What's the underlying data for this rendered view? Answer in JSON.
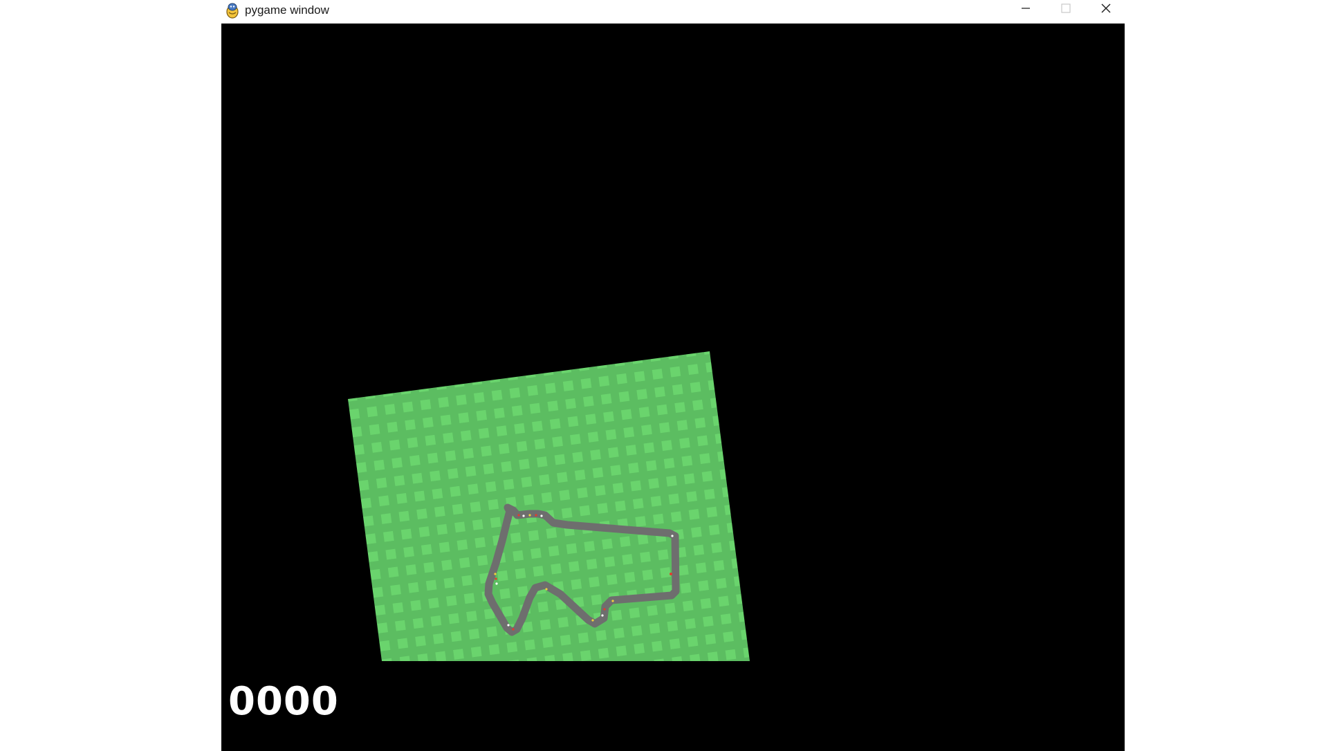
{
  "window": {
    "title": "pygame window",
    "icons": {
      "app": "pygame-snake-icon",
      "minimize": "minimize-icon",
      "maximize": "maximize-icon",
      "close": "close-icon"
    }
  },
  "game": {
    "score": "0000",
    "colors": {
      "background": "#000000",
      "grass": "#5cbd61",
      "grass_tile": "#6ad46d",
      "track": "#6e6e6e",
      "kerb_red": "#e23b2e",
      "kerb_white": "#ffffff",
      "kerb_yellow": "#f2d23b",
      "score_text": "#ffffff"
    }
  }
}
